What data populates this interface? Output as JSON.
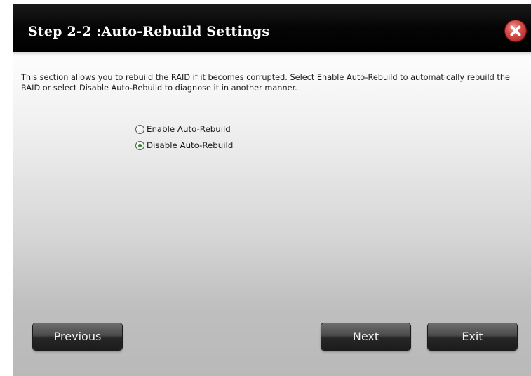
{
  "dialog": {
    "title": "Step 2-2 :Auto-Rebuild Settings",
    "description": "This section allows you to rebuild the RAID if it becomes corrupted. Select Enable Auto-Rebuild to automatically rebuild the RAID or select Disable Auto-Rebuild to diagnose it in another manner.",
    "options": [
      {
        "label": "Enable Auto-Rebuild",
        "checked": false
      },
      {
        "label": "Disable Auto-Rebuild",
        "checked": true
      }
    ],
    "buttons": {
      "previous": "Previous",
      "next": "Next",
      "exit": "Exit"
    },
    "close_icon": "close-icon"
  },
  "colors": {
    "titlebar": "#000000",
    "title_text": "#ffffff",
    "close_button": "#d9534f",
    "button_face": "#3a3a3a",
    "button_text": "#f2f2f2",
    "radio_selected": "#2a8a2a"
  }
}
